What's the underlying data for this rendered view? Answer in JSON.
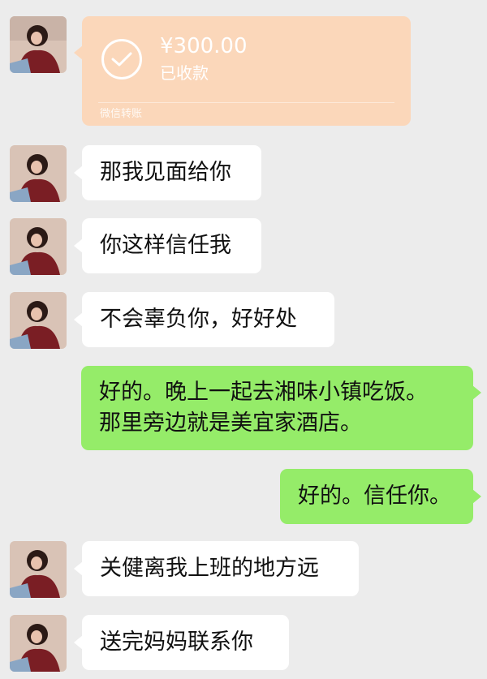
{
  "transfer": {
    "amount": "¥300.00",
    "status": "已收款",
    "footer": "微信转账",
    "icon": "check-icon",
    "color": "#fbd7ba"
  },
  "messages": [
    {
      "side": "left",
      "text": "那我见面给你"
    },
    {
      "side": "left",
      "text": "你这样信任我"
    },
    {
      "side": "left",
      "text": "不会辜负你，好好处"
    },
    {
      "side": "right",
      "text": "好的。晚上一起去湘味小镇吃饭。\n那里旁边就是美宜家酒店。"
    },
    {
      "side": "right",
      "text": "好的。信任你。"
    },
    {
      "side": "left",
      "text": "关健离我上班的地方远"
    },
    {
      "side": "left",
      "text": "送完妈妈联系你"
    }
  ],
  "colors": {
    "background": "#ececec",
    "left_bubble": "#ffffff",
    "right_bubble": "#95ec69"
  }
}
